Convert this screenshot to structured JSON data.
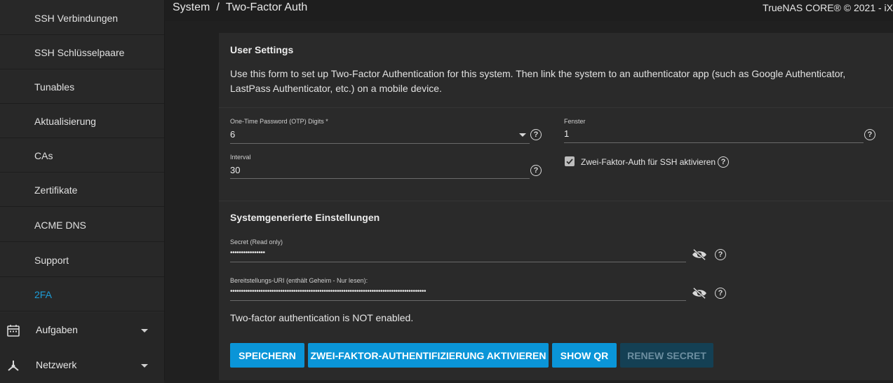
{
  "sidebar": {
    "items": [
      {
        "label": "SSH Verbindungen"
      },
      {
        "label": "SSH Schlüsselpaare"
      },
      {
        "label": "Tunables"
      },
      {
        "label": "Aktualisierung"
      },
      {
        "label": "CAs"
      },
      {
        "label": "Zertifikate"
      },
      {
        "label": "ACME DNS"
      },
      {
        "label": "Support"
      },
      {
        "label": "2FA",
        "active": true
      }
    ],
    "groups": [
      {
        "label": "Aufgaben",
        "icon": "calendar-icon"
      },
      {
        "label": "Netzwerk",
        "icon": "network-icon"
      }
    ]
  },
  "header": {
    "breadcrumb": [
      "System",
      "Two-Factor Auth"
    ],
    "separator": "/",
    "copyright": "TrueNAS CORE® © 2021 - iX"
  },
  "user_settings": {
    "title": "User Settings",
    "description": "Use this form to set up Two-Factor Authentication for this system. Then link the system to an authenticator app (such as Google Authenticator, LastPass Authenticator, etc.) on a mobile device.",
    "otp_digits": {
      "label": "One-Time Password (OTP) Digits *",
      "value": "6"
    },
    "window": {
      "label": "Fenster",
      "value": "1"
    },
    "interval": {
      "label": "Interval",
      "value": "30"
    },
    "ssh_2fa": {
      "label": "Zwei-Faktor-Auth für SSH aktivieren",
      "checked": true
    }
  },
  "generated": {
    "title": "Systemgenerierte Einstellungen",
    "secret": {
      "label": "Secret (Read only)",
      "value": "••••••••••••••••"
    },
    "uri": {
      "label": "Bereitstellungs-URI (enthält Geheim - Nur lesen):",
      "value": "••••••••••••••••••••••••••••••••••••••••••••••••••••••••••••••••••••••••••••••••••••••••••"
    }
  },
  "status_text": "Two-factor authentication is NOT enabled.",
  "buttons": {
    "save": "SPEICHERN",
    "enable": "ZWEI-FAKTOR-AUTHENTIFIZIERUNG AKTIVIEREN",
    "show_qr": "SHOW QR",
    "renew": "RENEW SECRET"
  },
  "help_glyph": "?",
  "colors": {
    "accent": "#0a95d8",
    "active_nav": "#1d9cd6",
    "background": "#202020",
    "card": "#2a2a2a"
  }
}
